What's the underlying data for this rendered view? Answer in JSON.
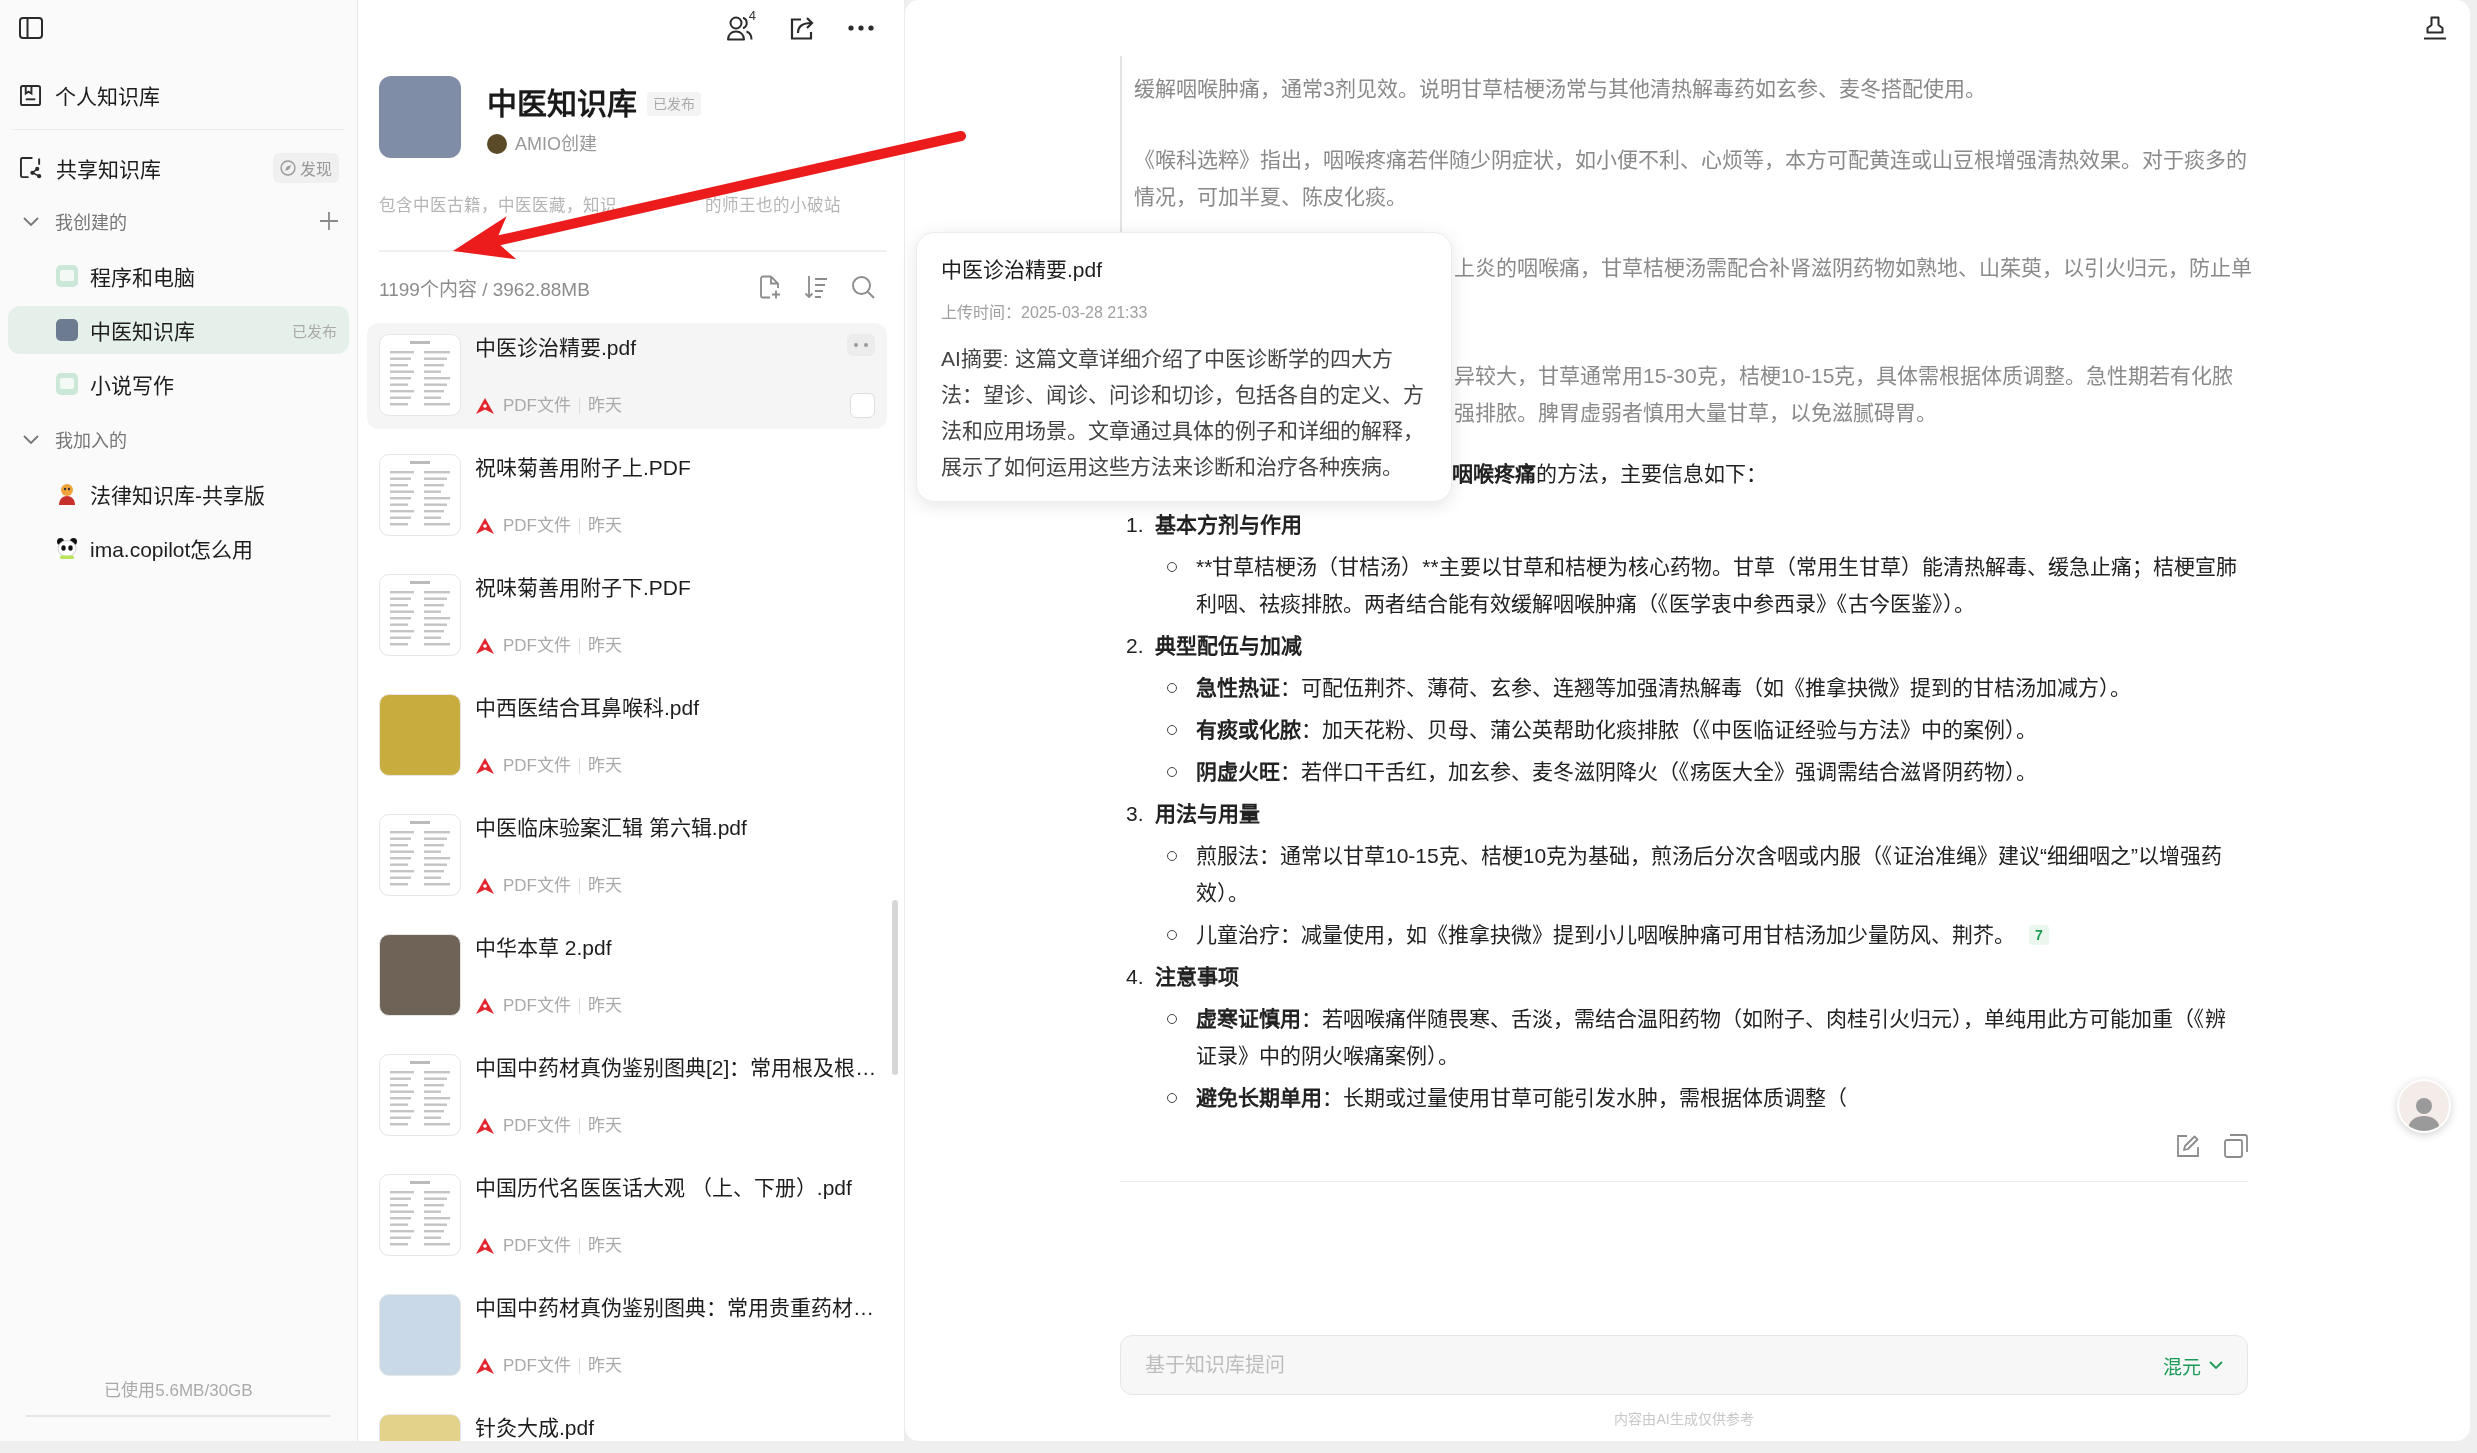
{
  "sidebar": {
    "personal": {
      "label": "个人知识库"
    },
    "shared": {
      "label": "共享知识库",
      "discover": "发现"
    },
    "sections": [
      {
        "title": "我创建的",
        "expanded": true,
        "add_button": true,
        "items": [
          {
            "label": "程序和电脑",
            "kind": "notebook",
            "selected": false
          },
          {
            "label": "中医知识库",
            "kind": "cover",
            "selected": true,
            "badge": "已发布"
          },
          {
            "label": "小说写作",
            "kind": "notebook",
            "selected": false
          }
        ]
      },
      {
        "title": "我加入的",
        "expanded": true,
        "add_button": false,
        "items": [
          {
            "label": "法律知识库-共享版",
            "kind": "mascot",
            "selected": false
          },
          {
            "label": "ima.copilot怎么用",
            "kind": "panda",
            "selected": false
          }
        ]
      }
    ],
    "storage": "已使用5.6MB/30GB"
  },
  "library": {
    "members": "4",
    "title": "中医知识库",
    "status": "已发布",
    "creator": "AMIO创建",
    "description": [
      "包含中医古籍，中医医藏，知识",
      "的师王也的小破站"
    ],
    "stats": "1199个内容 / 3962.88MB"
  },
  "files": [
    {
      "name": "中医诊治精要.pdf",
      "type": "PDF文件",
      "time": "昨天",
      "selected": true,
      "kind": "page"
    },
    {
      "name": "祝味菊善用附子上.PDF",
      "type": "PDF文件",
      "time": "昨天",
      "selected": false,
      "kind": "page"
    },
    {
      "name": "祝味菊善用附子下.PDF",
      "type": "PDF文件",
      "time": "昨天",
      "selected": false,
      "kind": "page"
    },
    {
      "name": "中西医结合耳鼻喉科.pdf",
      "type": "PDF文件",
      "time": "昨天",
      "selected": false,
      "kind": "cover",
      "color": "#c9ac3e"
    },
    {
      "name": "中医临床验案汇辑 第六辑.pdf",
      "type": "PDF文件",
      "time": "昨天",
      "selected": false,
      "kind": "page"
    },
    {
      "name": "中华本草 2.pdf",
      "type": "PDF文件",
      "time": "昨天",
      "selected": false,
      "kind": "cover",
      "color": "#6f6357"
    },
    {
      "name": "中国中药材真伪鉴别图典[2]：常用根及根…",
      "type": "PDF文件",
      "time": "昨天",
      "selected": false,
      "kind": "page"
    },
    {
      "name": "中国历代名医医话大观 （上、下册）.pdf",
      "type": "PDF文件",
      "time": "昨天",
      "selected": false,
      "kind": "page"
    },
    {
      "name": "中国中药材真伪鉴别图典：常用贵重药材…",
      "type": "PDF文件",
      "time": "昨天",
      "selected": false,
      "kind": "cover",
      "color": "#c9d9e8"
    },
    {
      "name": "针灸大成.pdf",
      "selected": false,
      "kind": "cover",
      "color": "#e3d28a"
    }
  ],
  "popup": {
    "title": "中医诊治精要.pdf",
    "uploaded": "上传时间：2025-03-28 21:33",
    "summary": "AI摘要: 这篇文章详细介绍了中医诊断学的四大方法：望诊、闻诊、问诊和切诊，包括各自的定义、方法和应用场景。文章通过具体的例子和详细的解释，展示了如何运用这些方法来诊断和治疗各种疾病。"
  },
  "answer": {
    "quote": [
      {
        "kind": "paragraph",
        "text": "缓解咽喉肿痛，通常3剂见效。说明甘草桔梗汤常与其他清热解毒药如玄参、麦冬搭配使用。"
      },
      {
        "kind": "paragraph",
        "text": "《喉科选粹》指出，咽喉疼痛若伴随少阴症状，如小便不利、心烦等，本方可配黄连或山豆根增强清热效果。对于痰多的情况，可加半夏、陈皮化痰。"
      },
      {
        "kind": "fragment",
        "lines": [
          "上炎的咽喉痛，甘草桔梗汤需配合补肾滋阴药物如熟地、山茱萸，以引火归元，防止单"
        ]
      },
      {
        "kind": "fragment",
        "lines": [
          "异较大，甘草通常用15-30克，桔梗10-15克，具体需根据体质调整。急性期若有化脓",
          "强排脓。脾胃虚弱者慎用大量甘草，以免滋腻碍胃。"
        ]
      }
    ],
    "lead": {
      "term": "咽喉疼痛",
      "text": "的方法，主要信息如下："
    },
    "sections": [
      {
        "number": "1.",
        "title": "基本方剂与作用",
        "items": [
          {
            "text": "**甘草桔梗汤（甘桔汤）**主要以甘草和桔梗为核心药物。甘草（常用生甘草）能清热解毒、缓急止痛；桔梗宣肺利咽、祛痰排脓。两者结合能有效缓解咽喉肿痛（《医学衷中参西录》《古今医鉴》）。"
          }
        ]
      },
      {
        "number": "2.",
        "title": "典型配伍与加减",
        "items": [
          {
            "term": "急性热证",
            "text": "：可配伍荆芥、薄荷、玄参、连翘等加强清热解毒（如《推拿抉微》提到的甘桔汤加减方）。"
          },
          {
            "term": "有痰或化脓",
            "text": "：加天花粉、贝母、蒲公英帮助化痰排脓（《中医临证经验与方法》中的案例）。"
          },
          {
            "term": "阴虚火旺",
            "text": "：若伴口干舌红，加玄参、麦冬滋阴降火（《疡医大全》强调需结合滋肾阴药物）。"
          }
        ]
      },
      {
        "number": "3.",
        "title": "用法与用量",
        "items": [
          {
            "text": "煎服法：通常以甘草10-15克、桔梗10克为基础，煎汤后分次含咽或内服（《证治准绳》建议“细细咽之”以增强药效）。"
          },
          {
            "text": "儿童治疗：减量使用，如《推拿抉微》提到小儿咽喉肿痛可用甘桔汤加少量防风、荆芥。",
            "citation": "7"
          }
        ]
      },
      {
        "number": "4.",
        "title": "注意事项",
        "items": [
          {
            "term": "虚寒证慎用",
            "text": "：若咽喉痛伴随畏寒、舌淡，需结合温阳药物（如附子、肉桂引火归元），单纯用此方可能加重（《辨证录》中的阴火喉痛案例）。"
          },
          {
            "term": "避免长期单用",
            "text": "：长期或过量使用甘草可能引发水肿，需根据体质调整（"
          }
        ]
      }
    ]
  },
  "composer": {
    "placeholder": "基于知识库提问",
    "model": "混元",
    "disclaimer": "内容由AI生成仅供参考"
  }
}
